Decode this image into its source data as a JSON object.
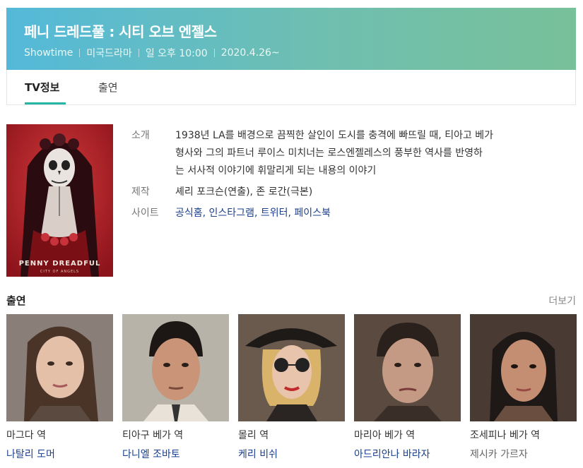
{
  "header": {
    "title": "페니 드레드풀 : 시티 오브 엔젤스",
    "meta": [
      "Showtime",
      "미국드라마",
      "일 오후 10:00",
      "2020.4.26~"
    ]
  },
  "tabs": [
    {
      "label": "TV정보",
      "active": true
    },
    {
      "label": "출연",
      "active": false
    }
  ],
  "poster": {
    "title_line1": "PENNY DREADFUL",
    "title_line2": "CITY OF ANGELS"
  },
  "info": {
    "intro_label": "소개",
    "intro_text_lines": [
      "1938년 LA를 배경으로 끔찍한 살인이 도시를 충격에 빠뜨릴 때, 티아고 베가",
      "형사와 그의 파트너 루이스 미치너는 로스엔젤레스의 풍부한 역사를 반영하",
      "는 서사적 이야기에 휘말리게 되는 내용의 이야기"
    ],
    "production_label": "제작",
    "production_text": "셰리 포크슨(연출), 존 로간(극본)",
    "site_label": "사이트",
    "sites": [
      "공식홈",
      "인스타그램",
      "트위터",
      "페이스북"
    ]
  },
  "cast_section": {
    "title": "출연",
    "more": "더보기",
    "members": [
      {
        "role": "마그다 역",
        "actor": "나탈리 도머"
      },
      {
        "role": "티아구 베가 역",
        "actor": "다니엘 조바토"
      },
      {
        "role": "몰리 역",
        "actor": "케리 비쉬"
      },
      {
        "role": "마리아 베가 역",
        "actor": "아드리안나 바라자"
      },
      {
        "role": "조세피나 베가 역",
        "actor": "제시카 가르자"
      }
    ]
  },
  "colors": {
    "header_gradient_start": "#54b9d9",
    "header_gradient_end": "#78c09a",
    "tab_underline": "#26b5a4",
    "link": "#1a3f8c",
    "poster_red": "#b5202a"
  }
}
